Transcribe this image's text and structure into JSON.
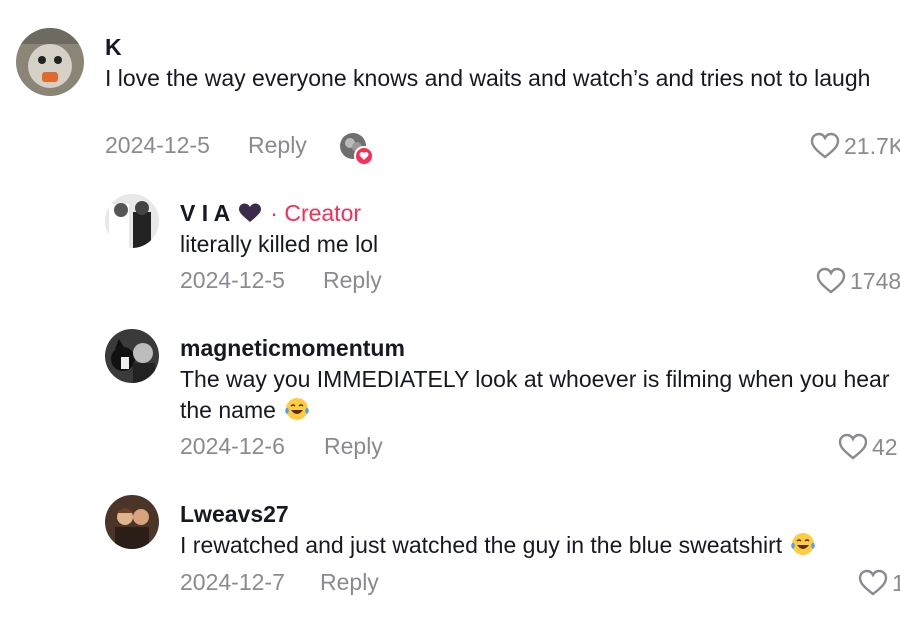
{
  "comments": [
    {
      "username": "K",
      "text": "I love the way everyone knows and waits and watch’s and tries not to laugh",
      "date": "2024-12-5",
      "reply_label": "Reply",
      "likes": "21.7K",
      "creator_liked": true
    },
    {
      "username": "V I A",
      "creator_label": "· Creator",
      "text": "literally killed me lol",
      "date": "2024-12-5",
      "reply_label": "Reply",
      "likes": "1748"
    },
    {
      "username": "magneticmomentum",
      "text": "The way you IMMEDIATELY look at whoever is filming when you hear the name",
      "date": "2024-12-6",
      "reply_label": "Reply",
      "likes": "42"
    },
    {
      "username": "Lweavs27",
      "text": "I rewatched and just watched the guy in the blue sweatshirt",
      "date": "2024-12-7",
      "reply_label": "Reply",
      "likes": "1"
    }
  ],
  "colors": {
    "accent": "#fe2c55",
    "muted": "#8a8b91",
    "text": "#161823",
    "heart_purple": "#3b2a4a"
  },
  "icons": {
    "like": "heart-outline-icon",
    "emoji": "laughing-tears-emoji-icon",
    "name_heart": "purple-heart-icon",
    "liked_badge": "heart-badge-icon"
  }
}
